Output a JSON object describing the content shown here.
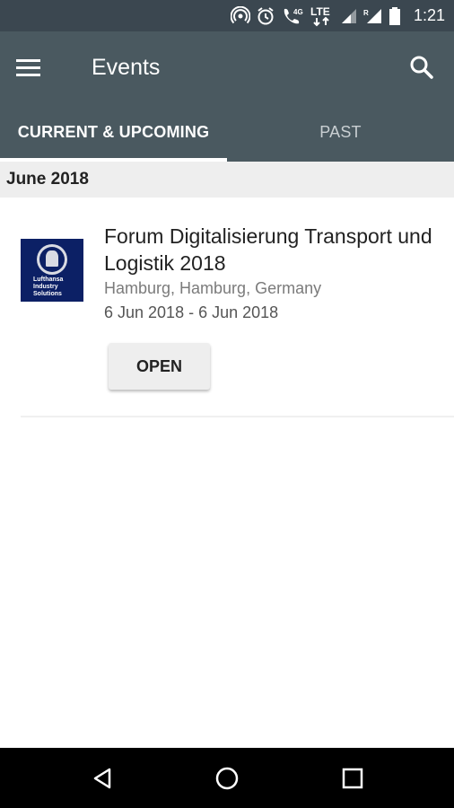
{
  "status_bar": {
    "time": "1:21",
    "network": "LTE",
    "network_small": "4G",
    "roaming": "R",
    "icons": [
      "hotspot-icon",
      "alarm-icon",
      "call-icon",
      "signal-icon",
      "battery-icon"
    ]
  },
  "app_bar": {
    "title": "Events",
    "menu_icon": "menu-icon",
    "search_icon": "search-icon"
  },
  "tabs": [
    {
      "label": "CURRENT & UPCOMING",
      "active": true
    },
    {
      "label": "PAST",
      "active": false
    }
  ],
  "section": {
    "header": "June 2018"
  },
  "events": [
    {
      "title": "Forum Digitalisierung Transport und Logistik 2018",
      "location": "Hamburg, Hamburg, Germany",
      "dates": "6 Jun 2018 - 6 Jun 2018",
      "button_label": "OPEN",
      "logo": {
        "line1": "Lufthansa",
        "line2": "Industry",
        "line3": "Solutions"
      }
    }
  ],
  "nav_bar": {
    "icons": [
      "back-icon",
      "home-icon",
      "recents-icon"
    ]
  },
  "colors": {
    "status_bar": "#3b4750",
    "app_bar": "#4a5960",
    "section_header": "#eeeeee",
    "logo_bg": "#0c2065"
  }
}
